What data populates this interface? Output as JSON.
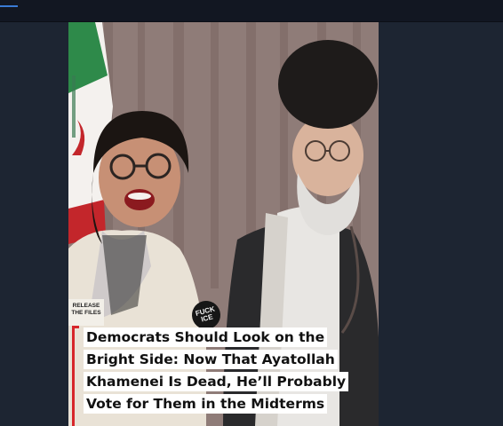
{
  "caption": {
    "lines": [
      "Democrats Should Look on the",
      "Bright Side: Now That Ayatollah",
      "Khamenei Is Dead, He’ll Probably",
      "Vote for Them in the Midterms"
    ]
  },
  "badges": {
    "release_files": "RELEASE THE FILES",
    "button_line1": "FUCK",
    "button_line2": "ICE"
  },
  "colors": {
    "page_background": "#1b2230",
    "top_bar": "#121722",
    "caption_background": "#ffffff",
    "caption_text": "#111111",
    "accent_red": "#d7262b",
    "curtain": "#8c7a76"
  }
}
